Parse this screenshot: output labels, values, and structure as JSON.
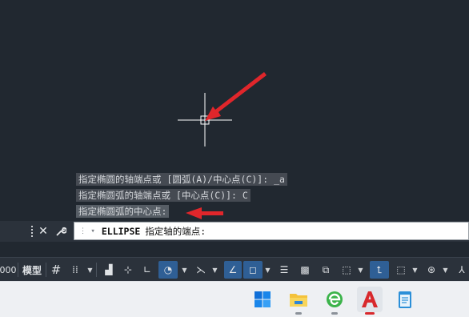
{
  "command_history": [
    "指定椭圆的轴端点或 [圆弧(A)/中心点(C)]: _a",
    "指定椭圆弧的轴端点或 [中心点(C)]: C",
    "指定椭圆弧的中心点:"
  ],
  "command_line": {
    "command": "ELLIPSE",
    "prompt": "指定轴的端点:"
  },
  "statusbar": {
    "coord_fragment": "000",
    "model_label": "模型"
  },
  "colors": {
    "canvas": "#212830",
    "annotation_arrow": "#e0262b",
    "crosshair": "#ffffff",
    "toggle_on": "#2f5f95"
  },
  "taskbar": {
    "apps": [
      "start-icon",
      "file-explorer-icon",
      "browser-icon",
      "autocad-icon",
      "notepad-icon"
    ]
  }
}
